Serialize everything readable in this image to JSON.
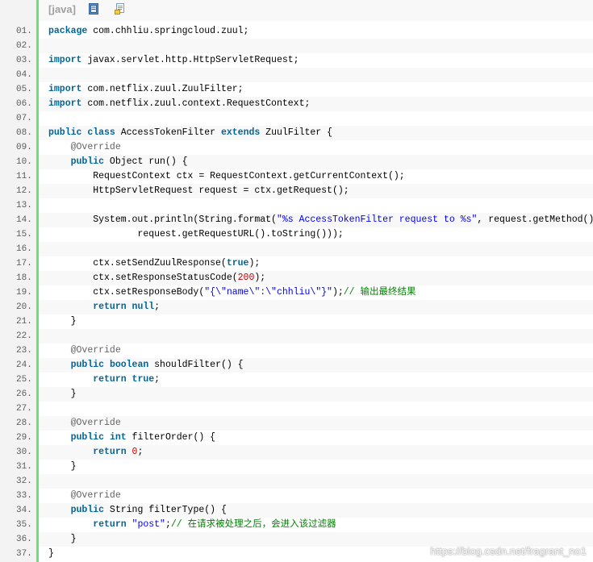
{
  "toolbar": {
    "language_label": "[java]",
    "copy_icon": "copy-icon",
    "print_icon": "print-icon"
  },
  "colors": {
    "keyword": "#006699",
    "annotation": "#646464",
    "string": "#0000ff",
    "number": "#c00000",
    "comment": "#008200",
    "gutter_bar": "#6ce26c"
  },
  "code_lines": [
    {
      "n": "01.",
      "parts": [
        {
          "t": "kw",
          "v": "package"
        },
        {
          "t": "p",
          "v": " com.chhliu.springcloud.zuul;"
        }
      ]
    },
    {
      "n": "02.",
      "parts": []
    },
    {
      "n": "03.",
      "parts": [
        {
          "t": "kw",
          "v": "import"
        },
        {
          "t": "p",
          "v": " javax.servlet.http.HttpServletRequest;"
        }
      ]
    },
    {
      "n": "04.",
      "parts": []
    },
    {
      "n": "05.",
      "parts": [
        {
          "t": "kw",
          "v": "import"
        },
        {
          "t": "p",
          "v": " com.netflix.zuul.ZuulFilter;"
        }
      ]
    },
    {
      "n": "06.",
      "parts": [
        {
          "t": "kw",
          "v": "import"
        },
        {
          "t": "p",
          "v": " com.netflix.zuul.context.RequestContext;"
        }
      ]
    },
    {
      "n": "07.",
      "parts": []
    },
    {
      "n": "08.",
      "parts": [
        {
          "t": "kw",
          "v": "public"
        },
        {
          "t": "p",
          "v": " "
        },
        {
          "t": "kw",
          "v": "class"
        },
        {
          "t": "p",
          "v": " AccessTokenFilter "
        },
        {
          "t": "kw",
          "v": "extends"
        },
        {
          "t": "p",
          "v": " ZuulFilter {"
        }
      ]
    },
    {
      "n": "09.",
      "parts": [
        {
          "t": "p",
          "v": "    "
        },
        {
          "t": "an",
          "v": "@Override"
        }
      ]
    },
    {
      "n": "10.",
      "parts": [
        {
          "t": "p",
          "v": "    "
        },
        {
          "t": "kw",
          "v": "public"
        },
        {
          "t": "p",
          "v": " Object run() {"
        }
      ]
    },
    {
      "n": "11.",
      "parts": [
        {
          "t": "p",
          "v": "        RequestContext ctx = RequestContext.getCurrentContext();"
        }
      ]
    },
    {
      "n": "12.",
      "parts": [
        {
          "t": "p",
          "v": "        HttpServletRequest request = ctx.getRequest();"
        }
      ]
    },
    {
      "n": "13.",
      "parts": []
    },
    {
      "n": "14.",
      "parts": [
        {
          "t": "p",
          "v": "        System.out.println(String.format("
        },
        {
          "t": "st",
          "v": "\"%s AccessTokenFilter request to %s\""
        },
        {
          "t": "p",
          "v": ", request.getMethod(),"
        }
      ]
    },
    {
      "n": "15.",
      "parts": [
        {
          "t": "p",
          "v": "                request.getRequestURL().toString()));"
        }
      ]
    },
    {
      "n": "16.",
      "parts": []
    },
    {
      "n": "17.",
      "parts": [
        {
          "t": "p",
          "v": "        ctx.setSendZuulResponse("
        },
        {
          "t": "kw",
          "v": "true"
        },
        {
          "t": "p",
          "v": ");"
        }
      ]
    },
    {
      "n": "18.",
      "parts": [
        {
          "t": "p",
          "v": "        ctx.setResponseStatusCode("
        },
        {
          "t": "nm",
          "v": "200"
        },
        {
          "t": "p",
          "v": ");"
        }
      ]
    },
    {
      "n": "19.",
      "parts": [
        {
          "t": "p",
          "v": "        ctx.setResponseBody("
        },
        {
          "t": "st",
          "v": "\"{\\\"name\\\":\\\"chhliu\\\"}\""
        },
        {
          "t": "p",
          "v": ");"
        },
        {
          "t": "cm",
          "v": "// 输出最终结果"
        }
      ]
    },
    {
      "n": "20.",
      "parts": [
        {
          "t": "p",
          "v": "        "
        },
        {
          "t": "kw",
          "v": "return"
        },
        {
          "t": "p",
          "v": " "
        },
        {
          "t": "kw",
          "v": "null"
        },
        {
          "t": "p",
          "v": ";"
        }
      ]
    },
    {
      "n": "21.",
      "parts": [
        {
          "t": "p",
          "v": "    }"
        }
      ]
    },
    {
      "n": "22.",
      "parts": []
    },
    {
      "n": "23.",
      "parts": [
        {
          "t": "p",
          "v": "    "
        },
        {
          "t": "an",
          "v": "@Override"
        }
      ]
    },
    {
      "n": "24.",
      "parts": [
        {
          "t": "p",
          "v": "    "
        },
        {
          "t": "kw",
          "v": "public"
        },
        {
          "t": "p",
          "v": " "
        },
        {
          "t": "kw",
          "v": "boolean"
        },
        {
          "t": "p",
          "v": " shouldFilter() {"
        }
      ]
    },
    {
      "n": "25.",
      "parts": [
        {
          "t": "p",
          "v": "        "
        },
        {
          "t": "kw",
          "v": "return"
        },
        {
          "t": "p",
          "v": " "
        },
        {
          "t": "kw",
          "v": "true"
        },
        {
          "t": "p",
          "v": ";"
        }
      ]
    },
    {
      "n": "26.",
      "parts": [
        {
          "t": "p",
          "v": "    }"
        }
      ]
    },
    {
      "n": "27.",
      "parts": []
    },
    {
      "n": "28.",
      "parts": [
        {
          "t": "p",
          "v": "    "
        },
        {
          "t": "an",
          "v": "@Override"
        }
      ]
    },
    {
      "n": "29.",
      "parts": [
        {
          "t": "p",
          "v": "    "
        },
        {
          "t": "kw",
          "v": "public"
        },
        {
          "t": "p",
          "v": " "
        },
        {
          "t": "kw",
          "v": "int"
        },
        {
          "t": "p",
          "v": " filterOrder() {"
        }
      ]
    },
    {
      "n": "30.",
      "parts": [
        {
          "t": "p",
          "v": "        "
        },
        {
          "t": "kw",
          "v": "return"
        },
        {
          "t": "p",
          "v": " "
        },
        {
          "t": "nm",
          "v": "0"
        },
        {
          "t": "p",
          "v": ";"
        }
      ]
    },
    {
      "n": "31.",
      "parts": [
        {
          "t": "p",
          "v": "    }"
        }
      ]
    },
    {
      "n": "32.",
      "parts": []
    },
    {
      "n": "33.",
      "parts": [
        {
          "t": "p",
          "v": "    "
        },
        {
          "t": "an",
          "v": "@Override"
        }
      ]
    },
    {
      "n": "34.",
      "parts": [
        {
          "t": "p",
          "v": "    "
        },
        {
          "t": "kw",
          "v": "public"
        },
        {
          "t": "p",
          "v": " String filterType() {"
        }
      ]
    },
    {
      "n": "35.",
      "parts": [
        {
          "t": "p",
          "v": "        "
        },
        {
          "t": "kw",
          "v": "return"
        },
        {
          "t": "p",
          "v": " "
        },
        {
          "t": "st",
          "v": "\"post\""
        },
        {
          "t": "p",
          "v": ";"
        },
        {
          "t": "cm",
          "v": "// 在请求被处理之后，会进入该过滤器"
        }
      ]
    },
    {
      "n": "36.",
      "parts": [
        {
          "t": "p",
          "v": "    }"
        }
      ]
    },
    {
      "n": "37.",
      "parts": [
        {
          "t": "p",
          "v": "}"
        }
      ]
    }
  ],
  "watermark": "https://blog.csdn.net/fragrant_no1"
}
